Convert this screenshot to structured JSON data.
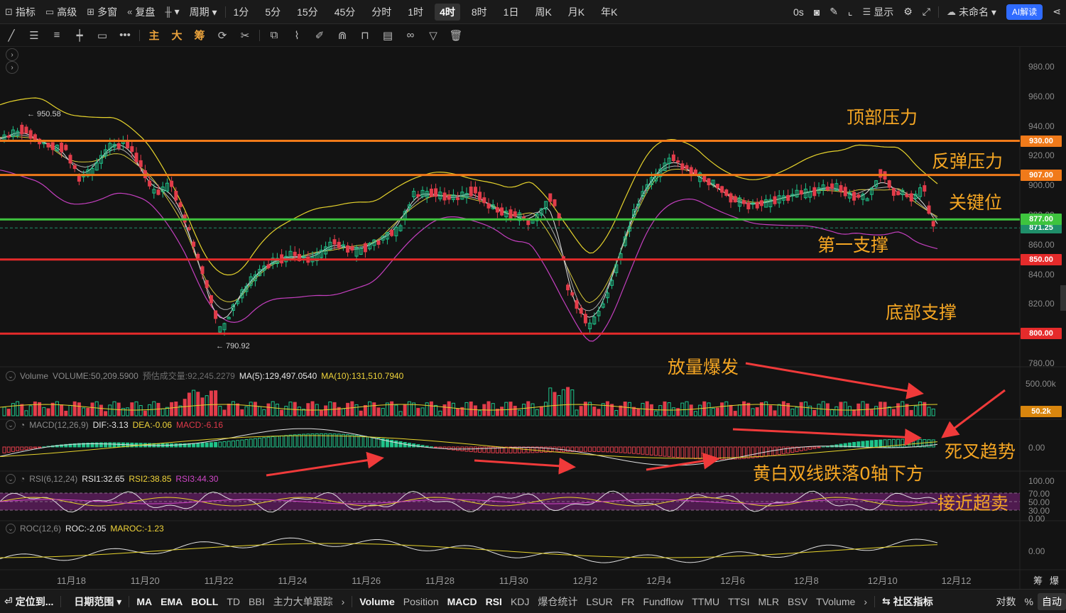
{
  "toolbar": {
    "left": [
      {
        "icon": "indicator-icon",
        "label": "指标"
      },
      {
        "icon": "advanced-icon",
        "label": "高级"
      },
      {
        "icon": "multi-window-icon",
        "label": "多窗"
      },
      {
        "icon": "replay-icon",
        "label": "复盘"
      },
      {
        "icon": "candle-type-icon",
        "label": "▾"
      },
      {
        "icon": "",
        "label": "周期 ▾"
      }
    ],
    "periods": [
      "1分",
      "5分",
      "15分",
      "45分",
      "分时",
      "1时",
      "4时",
      "8时",
      "1日",
      "周K",
      "月K",
      "年K"
    ],
    "active_period": "4时",
    "right": {
      "countdown": "0s",
      "display_label": "显示",
      "account_label": "未命名 ▾",
      "ai_label": "AI解读"
    }
  },
  "drawing_toolbar": {
    "tools": [
      "line-tool-icon",
      "parallel-tool-icon",
      "hline-tool-icon",
      "cross-tool-icon",
      "rect-tool-icon",
      "more-tool-icon"
    ],
    "cn_tools": [
      "主",
      "大",
      "筹"
    ]
  },
  "price_axis": {
    "ticks": [
      "980.00",
      "960.00",
      "940.00",
      "920.00",
      "900.00",
      "880.00",
      "860.00",
      "840.00",
      "820.00",
      "800.00",
      "780.00"
    ],
    "current_price": "871.25",
    "levels": [
      {
        "label": "930.00",
        "color": "#f07a1a"
      },
      {
        "label": "907.00",
        "color": "#f07a1a"
      },
      {
        "label": "877.00",
        "color": "#3ec43e"
      },
      {
        "label": "850.00",
        "color": "#e52b2b"
      },
      {
        "label": "800.00",
        "color": "#e52b2b"
      }
    ],
    "high_marker": "← 950.58",
    "low_marker": "← 790.92"
  },
  "annotations": {
    "top_pressure": "顶部压力",
    "rebound_pressure": "反弹压力",
    "key_level": "关键位",
    "first_support": "第一支撑",
    "bottom_support": "底部支撑",
    "volume_burst": "放量爆发",
    "death_cross": "死叉趋势",
    "macd_note": "黄白双线跌落0轴下方",
    "rsi_note": "接近超卖"
  },
  "volume_panel": {
    "name": "Volume",
    "value": "VOLUME:50,209.5900",
    "estimate": "预估成交量:92,245.2279",
    "ma5": "MA(5):129,497.0540",
    "ma10": "MA(10):131,510.7940",
    "axis_top": "500.00k",
    "last_tag": "50.2k"
  },
  "macd_panel": {
    "name": "MACD(12,26,9)",
    "dif": "DIF:-3.13",
    "dea": "DEA:-0.06",
    "macd": "MACD:-6.16",
    "zero": "0.00"
  },
  "rsi_panel": {
    "name": "RSI(6,12,24)",
    "rsi1": "RSI1:32.65",
    "rsi2": "RSI2:38.85",
    "rsi3": "RSI3:44.30",
    "ticks": [
      "100.00",
      "70.00",
      "50.00",
      "30.00",
      "0.00"
    ]
  },
  "roc_panel": {
    "name": "ROC(12,6)",
    "roc": "ROC:-2.05",
    "maroc": "MAROC:-1.23",
    "zero": "0.00"
  },
  "date_axis": [
    "11月18",
    "11月20",
    "11月22",
    "11月24",
    "11月26",
    "11月28",
    "11月30",
    "12月2",
    "12月4",
    "12月6",
    "12月8",
    "12月10",
    "12月12"
  ],
  "date_axis_right": [
    "筹",
    "爆"
  ],
  "bottom_bar": {
    "goto": "定位到...",
    "date_range": "日期范围 ▾",
    "overlays": [
      "MA",
      "EMA",
      "BOLL",
      "TD",
      "BBI",
      "主力大单跟踪"
    ],
    "indicators": [
      "Volume",
      "Position",
      "MACD",
      "RSI",
      "KDJ",
      "爆仓统计",
      "LSUR",
      "FR",
      "Fundflow",
      "TTMU",
      "TTSI",
      "MLR",
      "BSV",
      "TVolume"
    ],
    "community": "社区指标",
    "log": "对数",
    "percent": "%",
    "auto": "自动"
  }
}
